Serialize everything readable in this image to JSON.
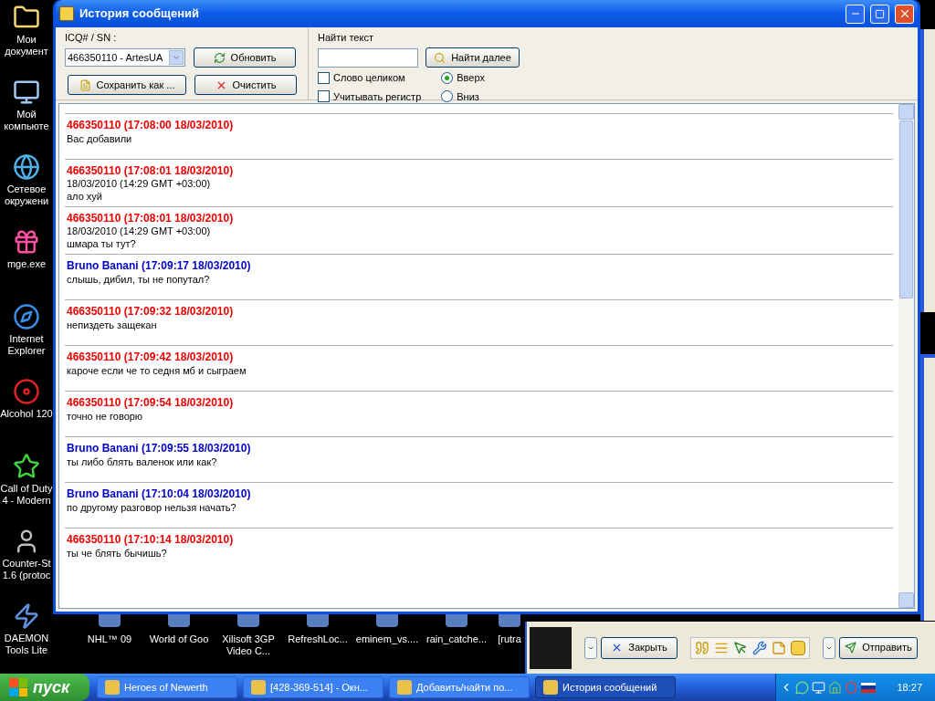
{
  "desktop_icons": [
    "Мои документ",
    "Мой компьюте",
    "Сетевое окружени",
    "mge.exe",
    "Internet Explorer",
    "Alcohol 120",
    "Call of Duty 4 - Modern",
    "Counter-St 1.6 (protoc",
    "DAEMON Tools Lite"
  ],
  "desktop_row": [
    "NHL™ 09",
    "World of Goo",
    "Xilisoft 3GP Video C...",
    "RefreshLoc...",
    "eminem_vs....",
    "rain_catche...",
    "[rutra"
  ],
  "window": {
    "title": "История сообщений"
  },
  "toolbar": {
    "contact_label": "ICQ# / SN :",
    "contact_value": "466350110 - ArtesUA",
    "refresh_button": "Обновить",
    "save_button": "Сохранить как ...",
    "clear_button": "Очистить",
    "search_label": "Найти текст",
    "find_next_button": "Найти далее",
    "options": [
      {
        "label": "Слово целиком",
        "checked": false
      },
      {
        "label": "Учитывать регистр",
        "checked": false
      }
    ],
    "directions": [
      {
        "label": "Вверх",
        "selected": true
      },
      {
        "label": "Вниз",
        "selected": false
      }
    ]
  },
  "messages": [
    {
      "header": "466350110 (17:08:00 18/03/2010)",
      "color": "#ee0000",
      "text": "Вас добавили"
    },
    {
      "header": "466350110 (17:08:01 18/03/2010)",
      "color": "#ee0000",
      "note": "18/03/2010 (14:29 GMT  +03:00)",
      "text": "ало хуй"
    },
    {
      "header": "466350110 (17:08:01 18/03/2010)",
      "color": "#ee0000",
      "note": "18/03/2010 (14:29 GMT  +03:00)",
      "text": "шмара ты тут?"
    },
    {
      "header": "Bruno Banani (17:09:17 18/03/2010)",
      "color": "#0000cc",
      "text": "слышь, дибил, ты не попутал?"
    },
    {
      "header": "466350110 (17:09:32 18/03/2010)",
      "color": "#ee0000",
      "text": "непиздеть защекан"
    },
    {
      "header": "466350110 (17:09:42 18/03/2010)",
      "color": "#ee0000",
      "text": "кароче если че то седня мб и сыграем"
    },
    {
      "header": "466350110 (17:09:54 18/03/2010)",
      "color": "#ee0000",
      "text": "точно не говорю"
    },
    {
      "header": "Bruno Banani (17:09:55 18/03/2010)",
      "color": "#0000cc",
      "text": "ты либо блять валенок или как?"
    },
    {
      "header": "Bruno Banani (17:10:04 18/03/2010)",
      "color": "#0000cc",
      "text": "по другому разговор нельзя начать?"
    },
    {
      "header": "466350110 (17:10:14 18/03/2010)",
      "color": "#ee0000",
      "text": "ты че блять бычишь?"
    }
  ],
  "chat_window": {
    "close_button": "Закрыть",
    "send_button": "Отправить"
  },
  "taskbar": {
    "start": "пуск",
    "tasks": [
      {
        "label": "Heroes of Newerth",
        "selected": false
      },
      {
        "label": "[428-369-514] - Окн...",
        "selected": false
      },
      {
        "label": "Добавить/найти по...",
        "selected": false
      },
      {
        "label": "История сообщений",
        "selected": true
      }
    ],
    "clock": "18:27"
  }
}
